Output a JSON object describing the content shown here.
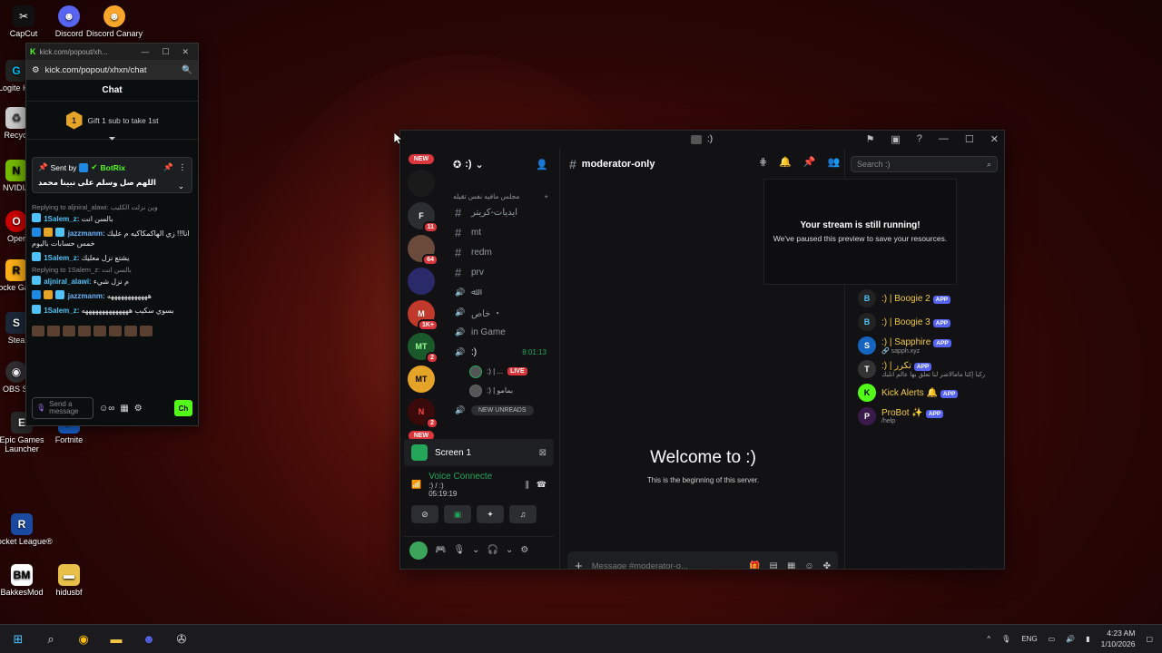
{
  "desktop": {
    "icons": [
      {
        "label": "CapCut"
      },
      {
        "label": "Discord"
      },
      {
        "label": "Discord Canary"
      },
      {
        "label": "Logite HU"
      },
      {
        "label": "Recycl"
      },
      {
        "label": "NVIDIA"
      },
      {
        "label": "Oper"
      },
      {
        "label": "Rocke Game"
      },
      {
        "label": "Stea"
      },
      {
        "label": "OBS St"
      },
      {
        "label": "Epic Games Launcher"
      },
      {
        "label": "Fortnite"
      },
      {
        "label": "Rocket League®"
      },
      {
        "label": "BakkesMod"
      },
      {
        "label": "hidusbf"
      }
    ]
  },
  "kick": {
    "tab_title": "kick.com/popout/xh...",
    "url": "kick.com/popout/xhxn/chat",
    "chat_title": "Chat",
    "gift_rank": "1",
    "gift_text": "Gift 1 sub to take 1st",
    "pinned": {
      "sent_by": "Sent by",
      "bot_name": "BotRix",
      "message": "اللهم صل وسلم على نبينا محمد"
    },
    "messages": [
      {
        "reply": "Replying to aljniral_alawi: وين نزلت الكليب",
        "user": "1Salem_z:",
        "text": "بالسن انت",
        "cls": "u1"
      },
      {
        "reply": "",
        "user": "jazzmanm:",
        "text": "انا!!! زي الهاكمكاكيه م عليك خمس حسابات باليوم",
        "cls": "u3"
      },
      {
        "reply": "",
        "user": "1Salem_z:",
        "text": "يشتع نزل معليك",
        "cls": "u1"
      },
      {
        "reply": "Replying to 1Salem_z: بالسن انت",
        "user": "aljniral_alawi:",
        "text": "م نزل شيء",
        "cls": "u1"
      },
      {
        "reply": "",
        "user": "jazzmanm:",
        "text": "ههههههههههههه",
        "cls": "u3"
      },
      {
        "reply": "",
        "user": "1Salem_z:",
        "text": "بسوي سكيب ههههههههههههههه",
        "cls": "u1"
      }
    ],
    "send_placeholder": "Send a message",
    "send_label": "Ch"
  },
  "discord": {
    "title": ":)",
    "server_name": ":)",
    "servers": [
      {
        "label": "NEW",
        "type": "pill"
      },
      {
        "label": "",
        "count": ""
      },
      {
        "label": "F",
        "count": "11"
      },
      {
        "label": "",
        "count": "64"
      },
      {
        "label": "",
        "count": ""
      },
      {
        "label": "M",
        "count": "1K+"
      },
      {
        "label": "MT",
        "count": "2"
      },
      {
        "label": "MT",
        "count": ""
      },
      {
        "label": "N",
        "count": "2"
      },
      {
        "label": "NEW",
        "type": "pill"
      }
    ],
    "category": "مجلس مافيه نفس تقيله",
    "channels": [
      {
        "icon": "#",
        "name": "ايديات-كريتر"
      },
      {
        "icon": "#",
        "name": "mt"
      },
      {
        "icon": "#",
        "name": "redm"
      },
      {
        "icon": "#",
        "name": "prv"
      },
      {
        "icon": "🔊",
        "name": "ﷲ"
      },
      {
        "icon": "🔊",
        "name": "خاص ・"
      },
      {
        "icon": "🔊",
        "name": "in Game"
      }
    ],
    "active_voice": {
      "name": ":)",
      "timer": "8:01:13"
    },
    "voice_users": [
      {
        "name": ":) | ...",
        "live": "LIVE"
      },
      {
        "name": ":) | بمامو",
        "live": ""
      }
    ],
    "new_unreads": "NEW UNREADS",
    "screen_label": "Screen 1",
    "voice_connected": "Voice Connecte",
    "voice_channel": ":) / :)",
    "voice_time": "05:19:19",
    "channel_name": "moderator-only",
    "search_placeholder": "Search :)",
    "stream_title": "Your stream is still running!",
    "stream_sub": "We've paused this preview to save your resources.",
    "welcome_title": "Welcome to :)",
    "welcome_sub": "This is the beginning of this server.",
    "composer_placeholder": "Message #moderator-o...",
    "members": [
      {
        "name": ":) | Boogie 2",
        "sub": "",
        "app": "APP",
        "color": "#f0c94a",
        "initial": "B"
      },
      {
        "name": ":) | Boogie 3",
        "sub": "",
        "app": "APP",
        "color": "#f0c94a",
        "initial": "B"
      },
      {
        "name": ":) | Sapphire",
        "sub": "🔗 sapph.xyz",
        "app": "APP",
        "color": "#f0c94a",
        "initial": "S"
      },
      {
        "name": ":) | تكرر",
        "sub": "ركبا إكنا مامالاضر لنا تعلق بها عالم انلبك",
        "app": "APP",
        "color": "#f0c94a",
        "initial": "T"
      },
      {
        "name": "Kick Alerts 🔔",
        "sub": "",
        "app": "APP",
        "color": "#f0c94a",
        "initial": "K"
      },
      {
        "name": "ProBot ✨",
        "sub": "/help",
        "app": "APP",
        "color": "#f0c94a",
        "initial": "P"
      }
    ]
  },
  "taskbar": {
    "lang": "ENG",
    "time": "4:23 AM",
    "date": "1/10/2026"
  }
}
